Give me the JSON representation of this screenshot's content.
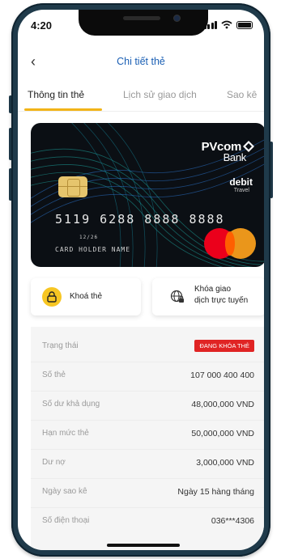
{
  "status": {
    "time": "4:20"
  },
  "header": {
    "title": "Chi tiết thẻ"
  },
  "tabs": [
    {
      "label": "Thông tin thẻ"
    },
    {
      "label": "Lịch sử giao dịch"
    },
    {
      "label": "Sao kê"
    }
  ],
  "card": {
    "brand_top": "PVcom",
    "brand_bottom": "Bank",
    "type": "debit",
    "subtype": "Travel",
    "number": "5119 6288 8888 8888",
    "expiry": "12/26",
    "holder": "CARD HOLDER NAME",
    "network_icon": "mastercard-logo"
  },
  "actions": {
    "lock_label": "Khoá thẻ",
    "online_label_1": "Khóa giao",
    "online_label_2": "dịch trực tuyến"
  },
  "details": [
    {
      "label": "Trạng thái",
      "value": "ĐANG KHÓA THẺ"
    },
    {
      "label": "Số thẻ",
      "value": "107 000 400 400"
    },
    {
      "label": "Số dư khả dụng",
      "value": "48,000,000 VND"
    },
    {
      "label": "Hạn mức thẻ",
      "value": "50,000,000 VND"
    },
    {
      "label": "Dư nợ",
      "value": "3,000,000 VND"
    },
    {
      "label": "Ngày sao kê",
      "value": "Ngày 15 hàng tháng"
    },
    {
      "label": "Số điện thoại",
      "value": "036***4306"
    }
  ],
  "colors": {
    "accent": "#f2b418",
    "title": "#1a5fb4",
    "badge": "#e02424"
  }
}
